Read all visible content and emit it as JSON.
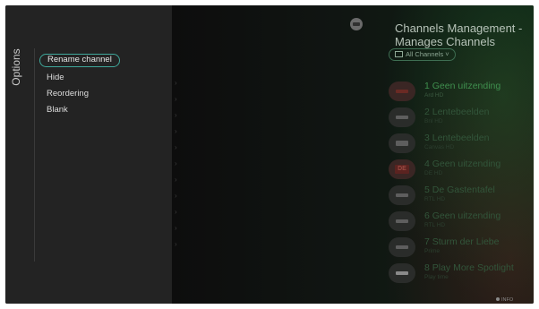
{
  "options_panel": {
    "title": "Options",
    "items": [
      {
        "label": "Rename channel",
        "selected": true
      },
      {
        "label": "Hide",
        "selected": false
      },
      {
        "label": "Reordering",
        "selected": false
      },
      {
        "label": "Blank",
        "selected": false
      }
    ]
  },
  "channels": {
    "title": "Channels Management - Manages Channels",
    "filter_label": "All Channels",
    "list": [
      {
        "name": "1 Geen uitzending",
        "sub": "Ard HD",
        "logo": "tv-logo-icon"
      },
      {
        "name": "2 Lentebeelden",
        "sub": "Bnl HD",
        "logo": "tv-logo-icon"
      },
      {
        "name": "3 Lentebeelden",
        "sub": "Canvas HD",
        "logo": "tv-logo-icon"
      },
      {
        "name": "4 Geen uitzending",
        "sub": "DE HD",
        "logo": "de-logo-icon"
      },
      {
        "name": "5 De Gastentafel",
        "sub": "RTL HD",
        "logo": "tv-logo-icon"
      },
      {
        "name": "6 Geen uitzending",
        "sub": "RTL HD",
        "logo": "tv-logo-icon"
      },
      {
        "name": "7 Sturm der Liebe",
        "sub": "Prime",
        "logo": "tv-logo-icon"
      },
      {
        "name": "8 Play More Spotlight",
        "sub": "Play time",
        "logo": "tv-logo-icon"
      }
    ],
    "footer_info": "INFO"
  }
}
